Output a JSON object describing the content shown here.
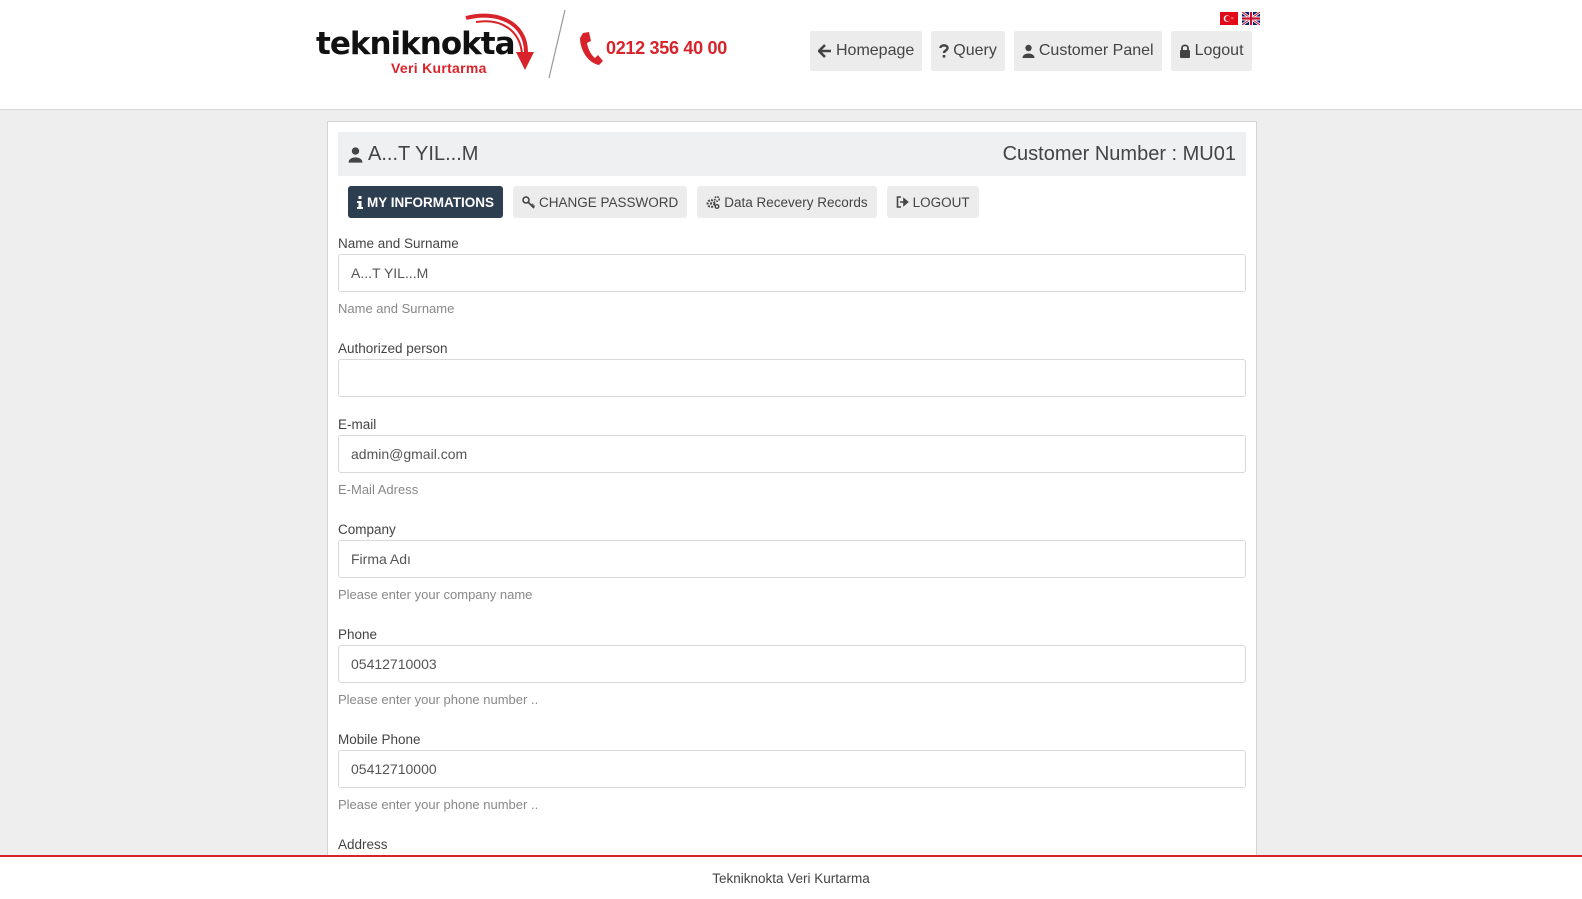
{
  "brand": {
    "name_main": "tekniknokta",
    "name_sub": "Veri Kurtarma",
    "phone": "0212 356 40 00",
    "accent_color": "#d8232a"
  },
  "languages": [
    {
      "icon": "flag-tr-icon"
    },
    {
      "icon": "flag-uk-icon"
    }
  ],
  "nav": {
    "homepage": "Homepage",
    "query": "Query",
    "customer_panel": "Customer Panel",
    "logout": "Logout"
  },
  "panel": {
    "user_name": "A...T YIL...M",
    "customer_number": "Customer Number : MU01"
  },
  "tabs": {
    "my_informations": "MY INFORMATIONS",
    "change_password": "CHANGE PASSWORD",
    "data_recovery": "Data Recevery Records",
    "logout": "LOGOUT"
  },
  "form": {
    "name": {
      "label": "Name and Surname",
      "value": "A...T YIL...M",
      "help": "Name and Surname"
    },
    "authorized": {
      "label": "Authorized person",
      "value": ""
    },
    "email": {
      "label": "E-mail",
      "value": "admin@gmail.com",
      "help": "E-Mail Adress"
    },
    "company": {
      "label": "Company",
      "value": "Firma Adı",
      "help": "Please enter your company name"
    },
    "phone": {
      "label": "Phone",
      "value": "05412710003",
      "help": "Please enter your phone number .."
    },
    "mobile": {
      "label": "Mobile Phone",
      "value": "05412710000",
      "help": "Please enter your phone number .."
    },
    "address": {
      "label": "Address"
    }
  },
  "footer": {
    "text": "Tekniknokta Veri Kurtarma"
  }
}
